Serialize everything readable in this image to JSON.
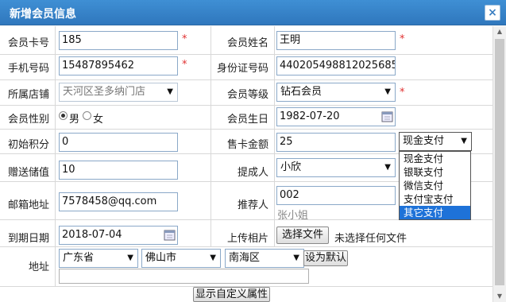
{
  "dialog": {
    "title": "新增会员信息",
    "close": "×"
  },
  "fields": {
    "card_no": {
      "label": "会员卡号",
      "value": "185"
    },
    "name": {
      "label": "会员姓名",
      "value": "王明"
    },
    "phone": {
      "label": "手机号码",
      "value": "15487895462"
    },
    "id_no": {
      "label": "身份证号码",
      "value": "440205498812025685"
    },
    "store": {
      "label": "所属店铺",
      "value": "天河区圣多纳门店"
    },
    "level": {
      "label": "会员等级",
      "value": "钻石会员"
    },
    "gender": {
      "label": "会员性别",
      "male": "男",
      "female": "女",
      "selected": "男"
    },
    "birthday": {
      "label": "会员生日",
      "value": "1982-07-20"
    },
    "points": {
      "label": "初始积分",
      "value": "0"
    },
    "card_price": {
      "label": "售卡金额",
      "value": "25"
    },
    "payment": {
      "value": "现金支付",
      "options": [
        "现金支付",
        "银联支付",
        "微信支付",
        "支付宝支付",
        "其它支付"
      ],
      "highlighted": "其它支付"
    },
    "bonus": {
      "label": "赠送储值",
      "value": "10"
    },
    "referrer_person": {
      "label": "提成人",
      "value": "小欣"
    },
    "email": {
      "label": "邮箱地址",
      "value": "7578458@qq.com"
    },
    "recommender": {
      "label": "推荐人",
      "value": "002",
      "name": "张小姐"
    },
    "expiry": {
      "label": "到期日期",
      "value": "2018-07-04"
    },
    "photo": {
      "label": "上传相片",
      "button": "选择文件",
      "status": "未选择任何文件"
    },
    "address": {
      "label": "地址",
      "province": "广东省",
      "city": "佛山市",
      "district": "南海区",
      "set_default": "设为默认",
      "detail": ""
    }
  },
  "required_mark": "*",
  "custom_attr_button": "显示自定义属性",
  "colors": {
    "title_bar": "#3f8fd4",
    "required": "#e03030",
    "dropdown_highlight": "#1e72d8"
  }
}
